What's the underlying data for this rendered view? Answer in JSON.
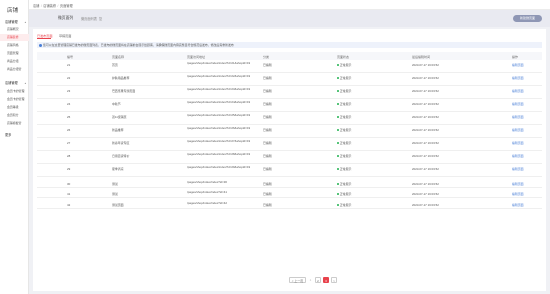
{
  "sidebar": {
    "logo": "店铺",
    "groups": [
      {
        "label": "店铺管理",
        "items": [
          "店铺概况",
          "店铺装修",
          "店铺风格",
          "页面管理",
          "商品分组",
          "商品分组管"
        ]
      },
      {
        "label": "店铺管理",
        "items": [
          "会员卡的管理",
          "会员卡的管理",
          "会员等级",
          "会员积分",
          "店铺模板管"
        ]
      }
    ],
    "more": "更多"
  },
  "topbar": {
    "breadcrumb": [
      "店铺",
      "店铺装修",
      "页面管理"
    ]
  },
  "page_header": {
    "title": "微页面列",
    "subtitle": "微页面列表",
    "copy_label": "复",
    "action_button": "新建微页面"
  },
  "tabs": [
    "已发布页面",
    "草稿页面"
  ],
  "notice": "您可以在这里管理店铺已发布的微页面列表，已发布的微页面将在店铺前台展示给顾客，请确保微页面内容完整且符合规范后发布，修改后需重新发布",
  "table": {
    "headers": [
      "编号",
      "页面名称",
      "页面访问地址",
      "分类",
      "页面状态",
      "最后编辑时间",
      "操作"
    ],
    "rows": [
      {
        "id": "21",
        "name": "首页",
        "path": "/pages/shop/index/index/index?id=21&shopId=19",
        "category": "已编辑",
        "status": "正常展示",
        "time": "2023-07-17 16:03:52",
        "action": "编辑页面"
      },
      {
        "id": "22",
        "name": "护肤用品推荐",
        "path": "/pages/shop/index/index/index?id=22&shopId=19",
        "category": "已编辑",
        "status": "正常展示",
        "time": "2023-07-17 16:03:52",
        "action": "编辑页面"
      },
      {
        "id": "23",
        "name": "巴西坚果专题页面",
        "path": "/pages/shop/index/index/index?id=23&shopId=19",
        "category": "已编辑",
        "status": "正常展示",
        "time": "2023-07-17 16:03:52",
        "action": "编辑页面"
      },
      {
        "id": "24",
        "name": "中秋节",
        "path": "/pages/shop/index/index/index?id=24&shopId=19",
        "category": "已编辑",
        "status": "正常展示",
        "time": "2023-07-17 16:03:52",
        "action": "编辑页面"
      },
      {
        "id": "25",
        "name": "双11促销页",
        "path": "/pages/shop/index/index/index?id=25&shopId=19",
        "category": "已编辑",
        "status": "正常展示",
        "time": "2023-07-17 16:03:52",
        "action": "编辑页面"
      },
      {
        "id": "26",
        "name": "新品推荐",
        "path": "/pages/shop/index/index/index?id=26&shopId=19",
        "category": "已编辑",
        "status": "正常展示",
        "time": "2023-07-17 16:03:52",
        "action": "编辑页面"
      },
      {
        "id": "27",
        "name": "新春年货专区",
        "path": "/pages/shop/index/index/index?id=27&shopId=19",
        "category": "已编辑",
        "status": "正常展示",
        "time": "2023-07-17 16:03:52",
        "action": "编辑页面"
      },
      {
        "id": "28",
        "name": "日用百货特价",
        "path": "/pages/shop/index/index/index?id=28&shopId=19",
        "category": "已编辑",
        "status": "正常展示",
        "time": "2023-07-17 16:03:52",
        "action": "编辑页面"
      },
      {
        "id": "29",
        "name": "夏季清凉",
        "path": "/pages/shop/index/index/index?id=29&shopId=19",
        "category": "已编辑",
        "status": "正常展示",
        "time": "2023-07-17 16:03:52",
        "action": "编辑页面"
      },
      {
        "id": "30",
        "name": "测试",
        "path": "/pages/shop/index/index?id=30",
        "category": "已编辑",
        "status": "正常展示",
        "time": "2023-07-17 16:03:52",
        "action": "编辑页面"
      },
      {
        "id": "41",
        "name": "测试",
        "path": "/pages/shop/index/index?id=41",
        "category": "已编辑",
        "status": "正常展示",
        "time": "2023-07-17 16:03:52",
        "action": "编辑页面"
      },
      {
        "id": "42",
        "name": "测试页面",
        "path": "/pages/shop/index/index?id=42",
        "category": "已编辑",
        "status": "正常展示",
        "time": "2023-07-17 16:03:52",
        "action": "编辑页面"
      }
    ]
  },
  "pagination": {
    "prev": "< 上一页",
    "pages": [
      "1",
      "2",
      "3"
    ],
    "current": "3",
    "next": ">"
  },
  "colors": {
    "accent": "#e8424c",
    "link": "#4a7fd6",
    "status_ok": "#2fb65a",
    "header_bg": "#e9eaf1",
    "primary_button": "#8f97b5"
  }
}
